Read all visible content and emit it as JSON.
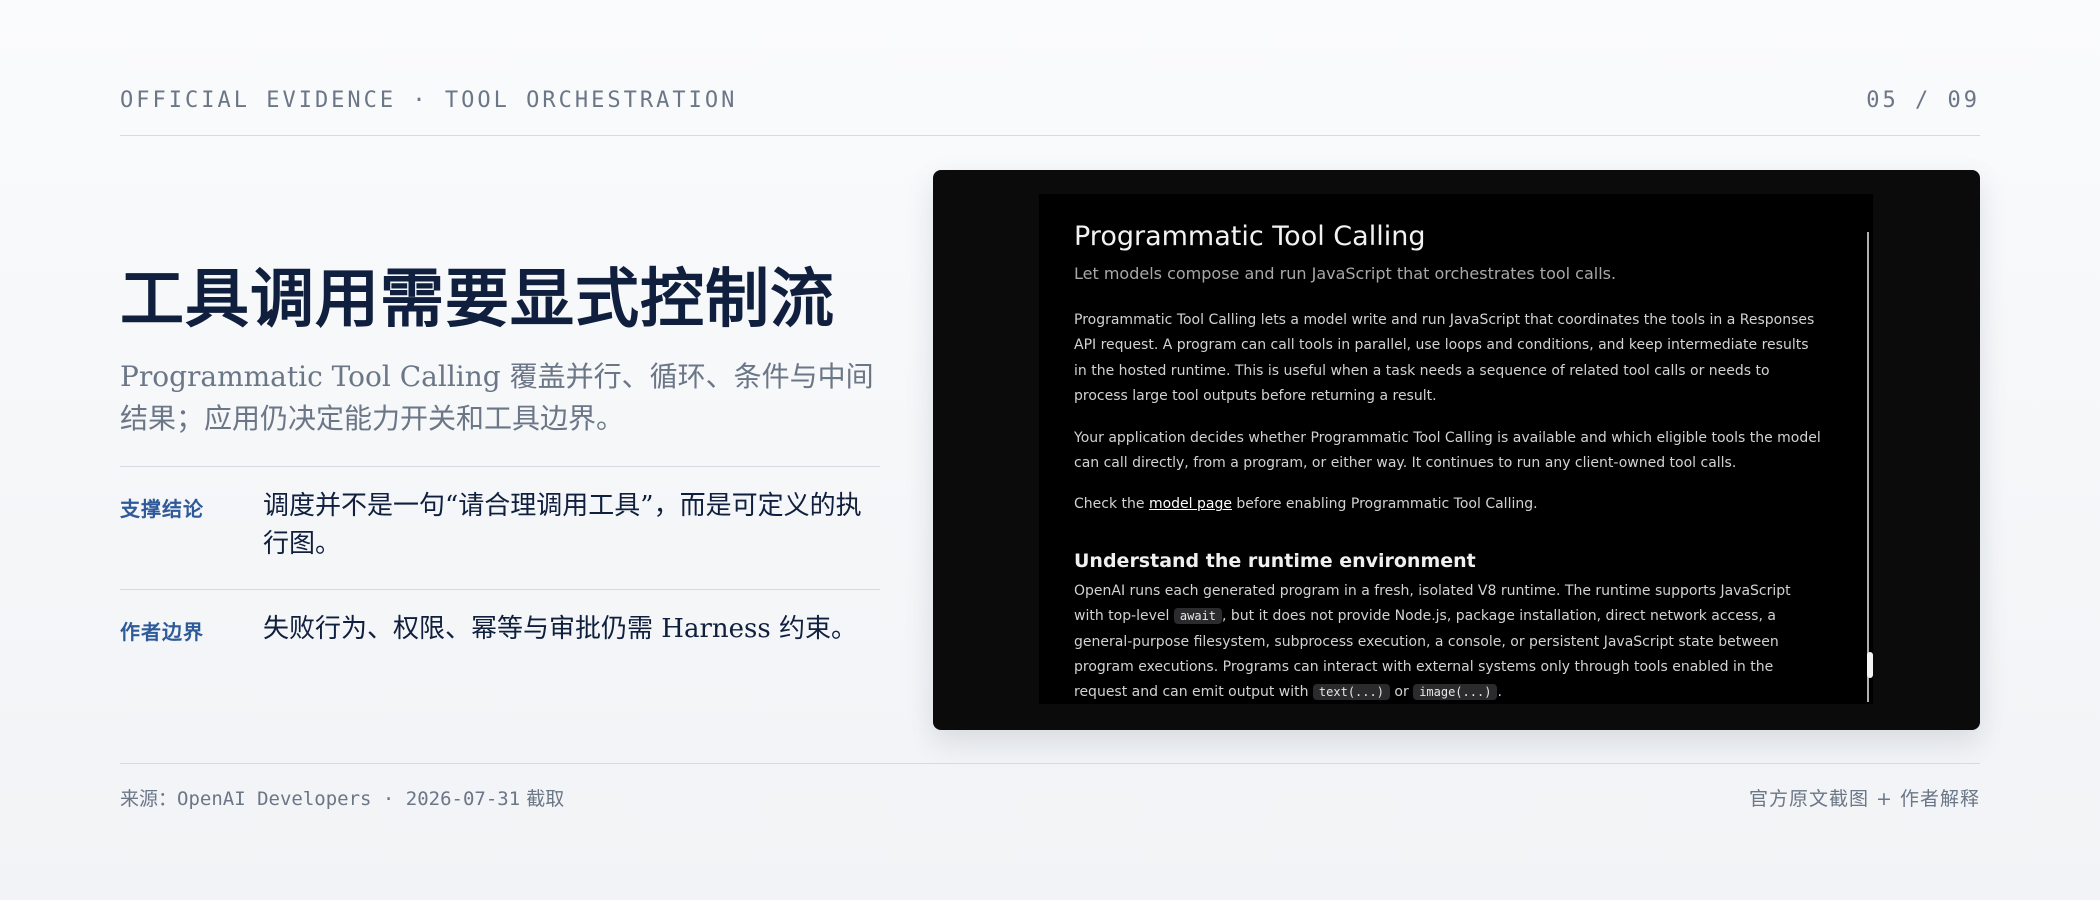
{
  "header": {
    "kicker": "OFFICIAL EVIDENCE · TOOL ORCHESTRATION",
    "page": "05 / 09"
  },
  "slide": {
    "title": "工具调用需要显式控制流",
    "subtitle": "Programmatic Tool Calling 覆盖并行、循环、条件与中间结果；应用仍决定能力开关和工具边界。",
    "rows": [
      {
        "label": "支撑结论",
        "text": "调度并不是一句“请合理调用工具”，而是可定义的执行图。"
      },
      {
        "label": "作者边界",
        "text": "失败行为、权限、幂等与审批仍需 Harness 约束。"
      }
    ]
  },
  "screenshot": {
    "title": "Programmatic Tool Calling",
    "lead": "Let models compose and run JavaScript that orchestrates tool calls.",
    "p1": "Programmatic Tool Calling lets a model write and run JavaScript that coordinates the tools in a Responses API request. A program can call tools in parallel, use loops and conditions, and keep intermediate results in the hosted runtime. This is useful when a task needs a sequence of related tool calls or needs to process large tool outputs before returning a result.",
    "p2": "Your application decides whether Programmatic Tool Calling is available and which eligible tools the model can call directly, from a program, or either way. It continues to run any client-owned tool calls.",
    "p3_before": "Check the ",
    "p3_link": "model page",
    "p3_after": " before enabling Programmatic Tool Calling.",
    "h2": "Understand the runtime environment",
    "p4_a": "OpenAI runs each generated program in a fresh, isolated V8 runtime. The runtime supports JavaScript with top-level ",
    "p4_code1": "await",
    "p4_b": ", but it does not provide Node.js, package installation, direct network access, a general-purpose filesystem, subprocess execution, a console, or persistent JavaScript state between program executions. Programs can interact with external systems only through tools enabled in the request and can emit output with ",
    "p4_code2": "text(...)",
    "p4_c": " or ",
    "p4_code3": "image(...)",
    "p4_d": "."
  },
  "footer": {
    "source_label": "来源：",
    "source": "OpenAI Developers · 2026-07-31",
    "source_suffix": " 截取",
    "credit": "官方原文截图 + 作者解释"
  }
}
